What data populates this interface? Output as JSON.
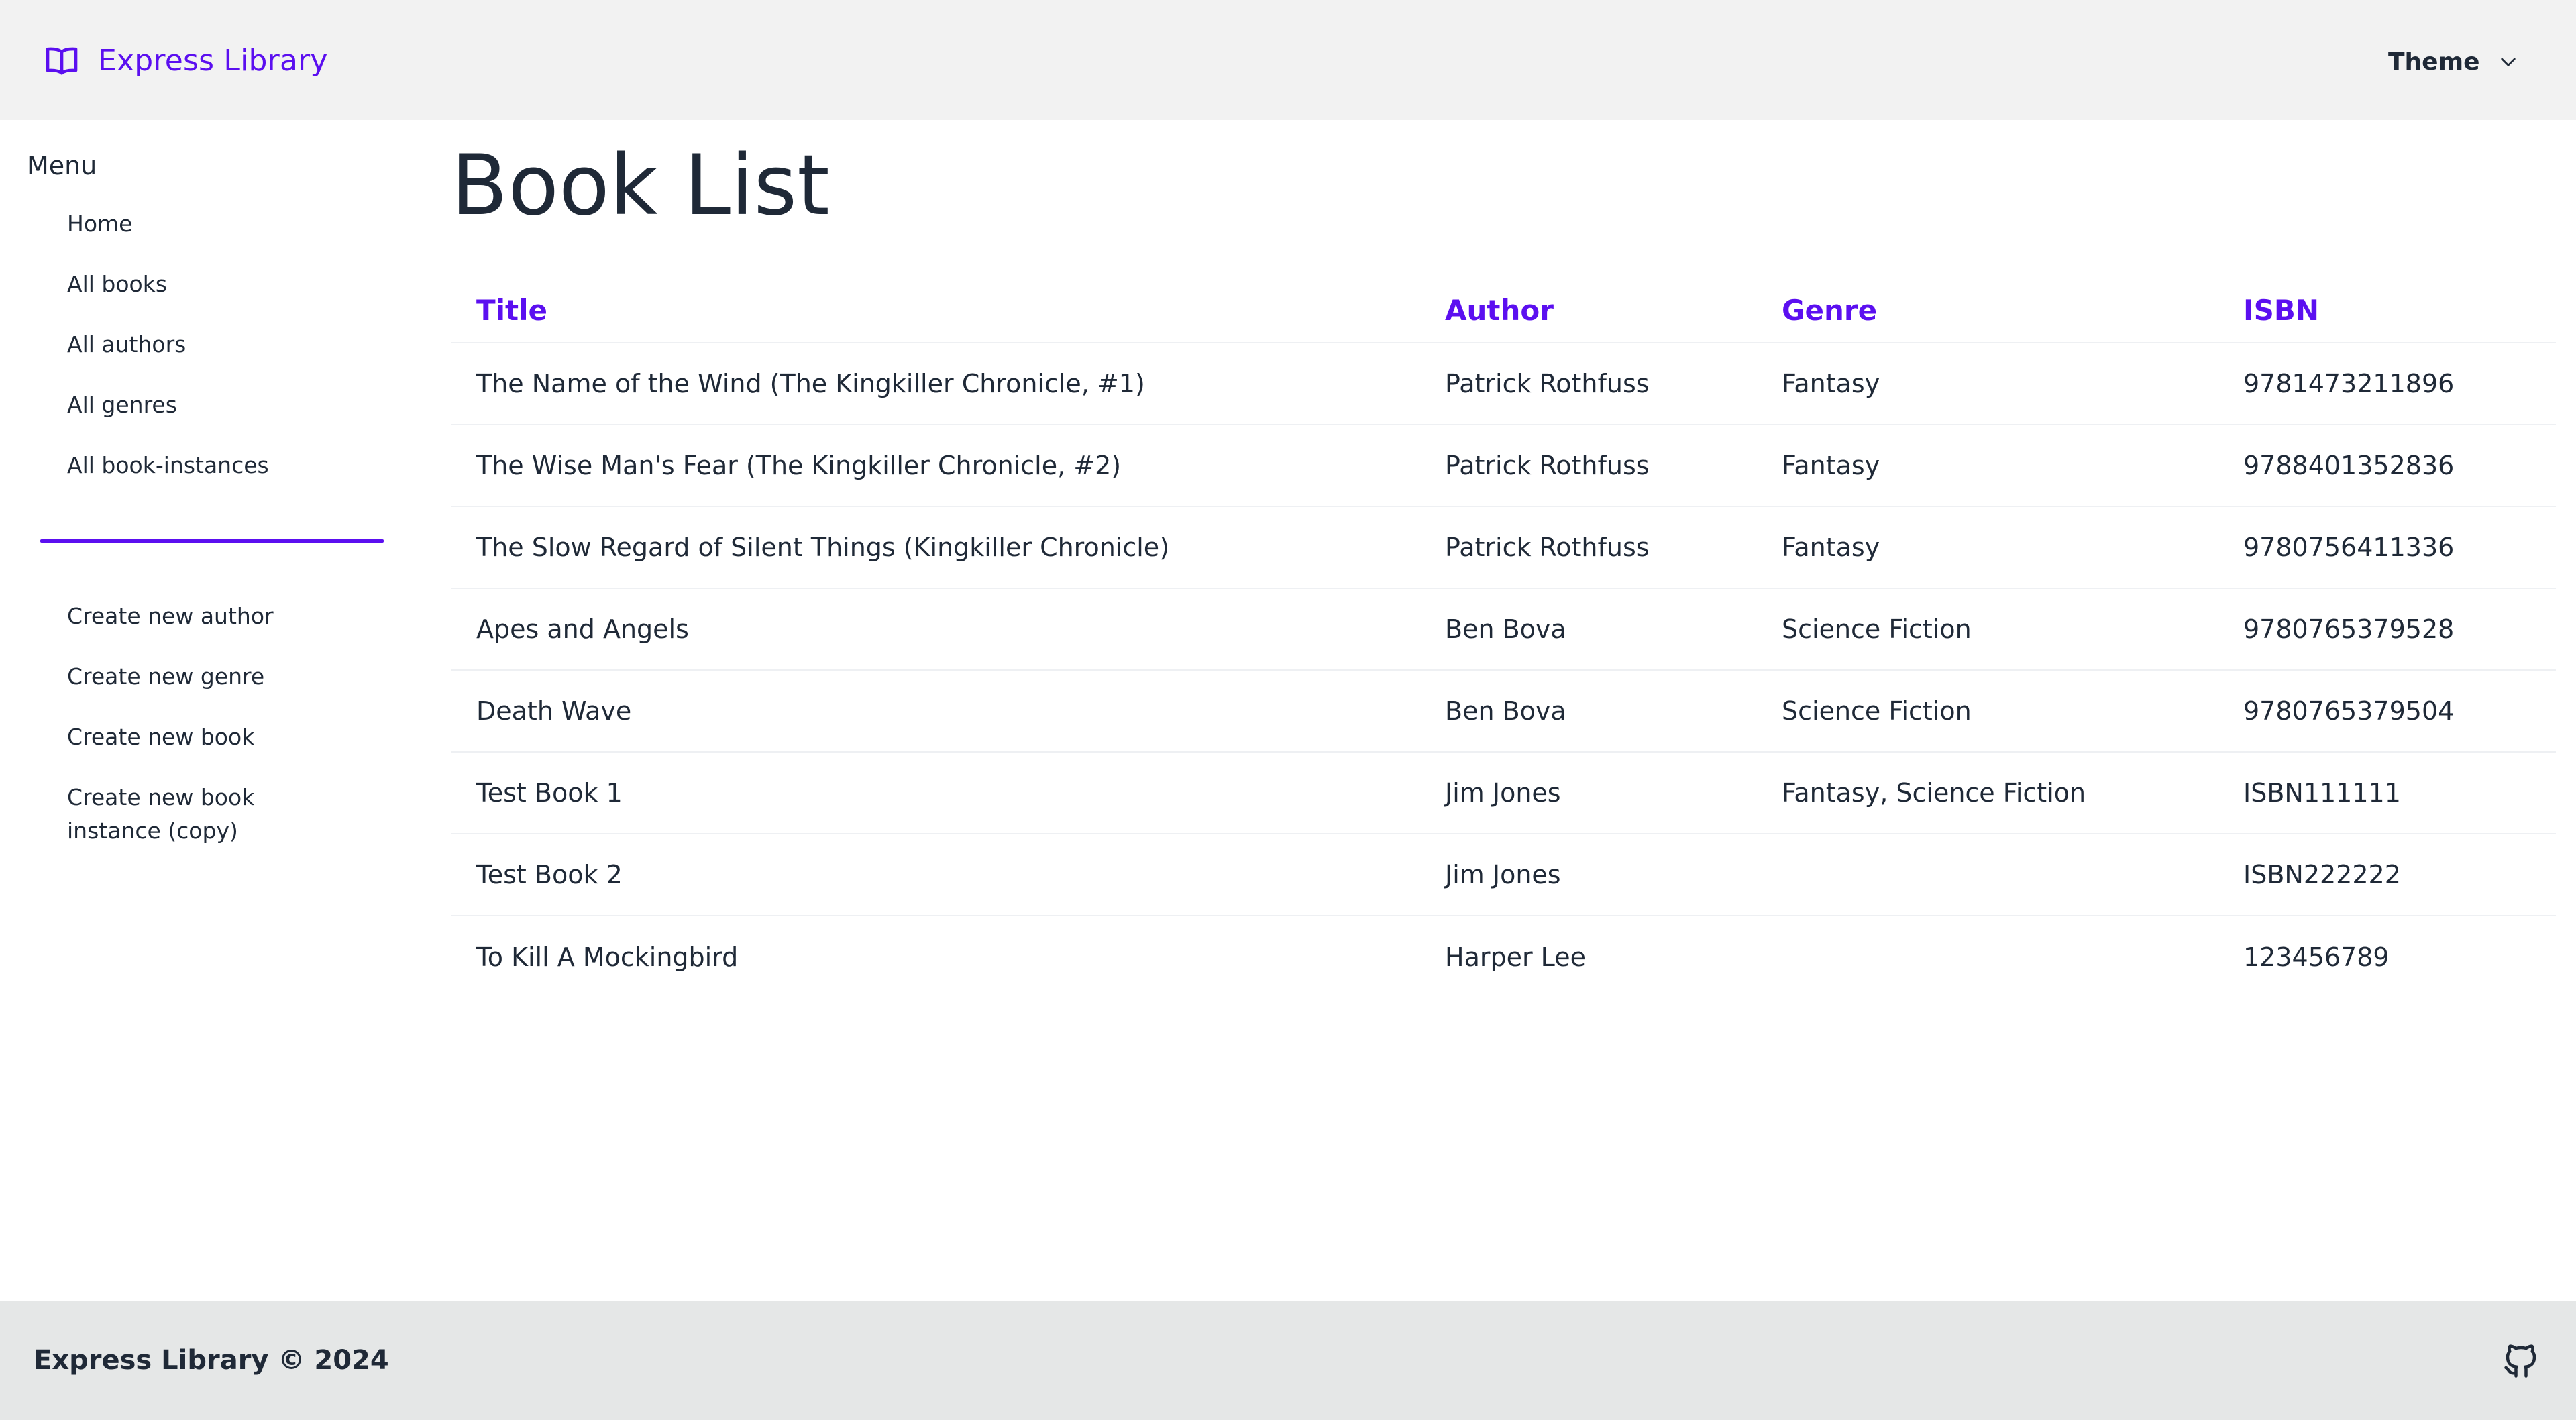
{
  "header": {
    "brand": "Express Library",
    "brand_icon": "book-open-icon",
    "theme_label": "Theme",
    "theme_icon": "chevron-down-icon"
  },
  "sidebar": {
    "title": "Menu",
    "primary": [
      {
        "label": "Home"
      },
      {
        "label": "All books"
      },
      {
        "label": "All authors"
      },
      {
        "label": "All genres"
      },
      {
        "label": "All book-instances"
      }
    ],
    "secondary": [
      {
        "label": "Create new author"
      },
      {
        "label": "Create new genre"
      },
      {
        "label": "Create new book"
      },
      {
        "label": "Create new book instance (copy)"
      }
    ]
  },
  "main": {
    "title": "Book List",
    "columns": [
      "Title",
      "Author",
      "Genre",
      "ISBN"
    ],
    "rows": [
      {
        "title": "The Name of the Wind (The Kingkiller Chronicle, #1)",
        "author": "Patrick Rothfuss",
        "genre": "Fantasy",
        "isbn": "9781473211896"
      },
      {
        "title": "The Wise Man's Fear (The Kingkiller Chronicle, #2)",
        "author": "Patrick Rothfuss",
        "genre": "Fantasy",
        "isbn": "9788401352836"
      },
      {
        "title": "The Slow Regard of Silent Things (Kingkiller Chronicle)",
        "author": "Patrick Rothfuss",
        "genre": "Fantasy",
        "isbn": "9780756411336"
      },
      {
        "title": "Apes and Angels",
        "author": "Ben Bova",
        "genre": "Science Fiction",
        "isbn": "9780765379528"
      },
      {
        "title": "Death Wave",
        "author": "Ben Bova",
        "genre": "Science Fiction",
        "isbn": "9780765379504"
      },
      {
        "title": "Test Book 1",
        "author": "Jim Jones",
        "genre": "Fantasy, Science Fiction",
        "isbn": "ISBN111111"
      },
      {
        "title": "Test Book 2",
        "author": "Jim Jones",
        "genre": "",
        "isbn": "ISBN222222"
      },
      {
        "title": "To Kill A Mockingbird",
        "author": "Harper Lee",
        "genre": "",
        "isbn": "123456789"
      }
    ]
  },
  "footer": {
    "text": "Express Library © 2024",
    "github_icon": "github-icon"
  },
  "colors": {
    "accent": "#5b0ff0",
    "header_bg": "#f2f2f2",
    "footer_bg": "#e5e7e7",
    "text": "#1f2937"
  }
}
